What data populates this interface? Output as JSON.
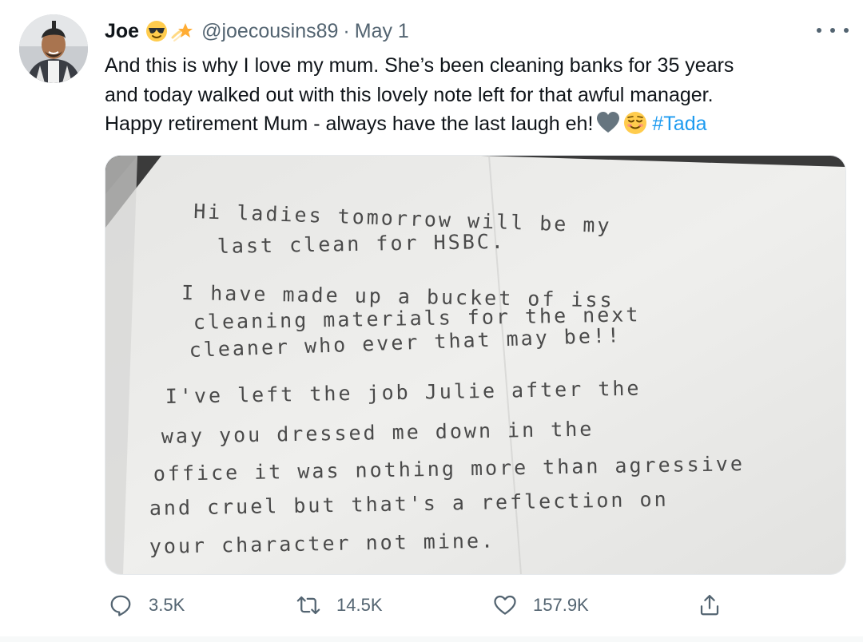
{
  "tweet": {
    "author": {
      "name": "Joe",
      "emojis": [
        "sunglasses-face-emoji",
        "shooting-star-emoji"
      ],
      "handle": "@joecousins89",
      "separator": "·",
      "date": "May 1"
    },
    "text_lines": [
      "And this is why I love my mum. She’s been cleaning banks for 35 years",
      "and today walked out with this lovely note left for that awful manager.",
      "Happy retirement Mum - always have the last laugh eh!"
    ],
    "text_emojis": [
      "grey-heart-emoji",
      "relieved-face-emoji"
    ],
    "hashtag": "#Tada",
    "media": {
      "note_lines": [
        "Hi ladies tomorrow will be my",
        "last clean for HSBC.",
        "I have made up a bucket of iss",
        "cleaning materials for the next",
        "cleaner who ever that may be!!",
        "I've left the job Julie after the",
        "way you dressed me down in the",
        "office it was nothing more than agressive",
        "and cruel but that's a reflection on",
        "your character not mine."
      ]
    },
    "actions": {
      "reply_count": "3.5K",
      "retweet_count": "14.5K",
      "like_count": "157.9K"
    },
    "colors": {
      "text": "#0f1419",
      "secondary": "#536471",
      "link": "#1d9bf0"
    }
  }
}
